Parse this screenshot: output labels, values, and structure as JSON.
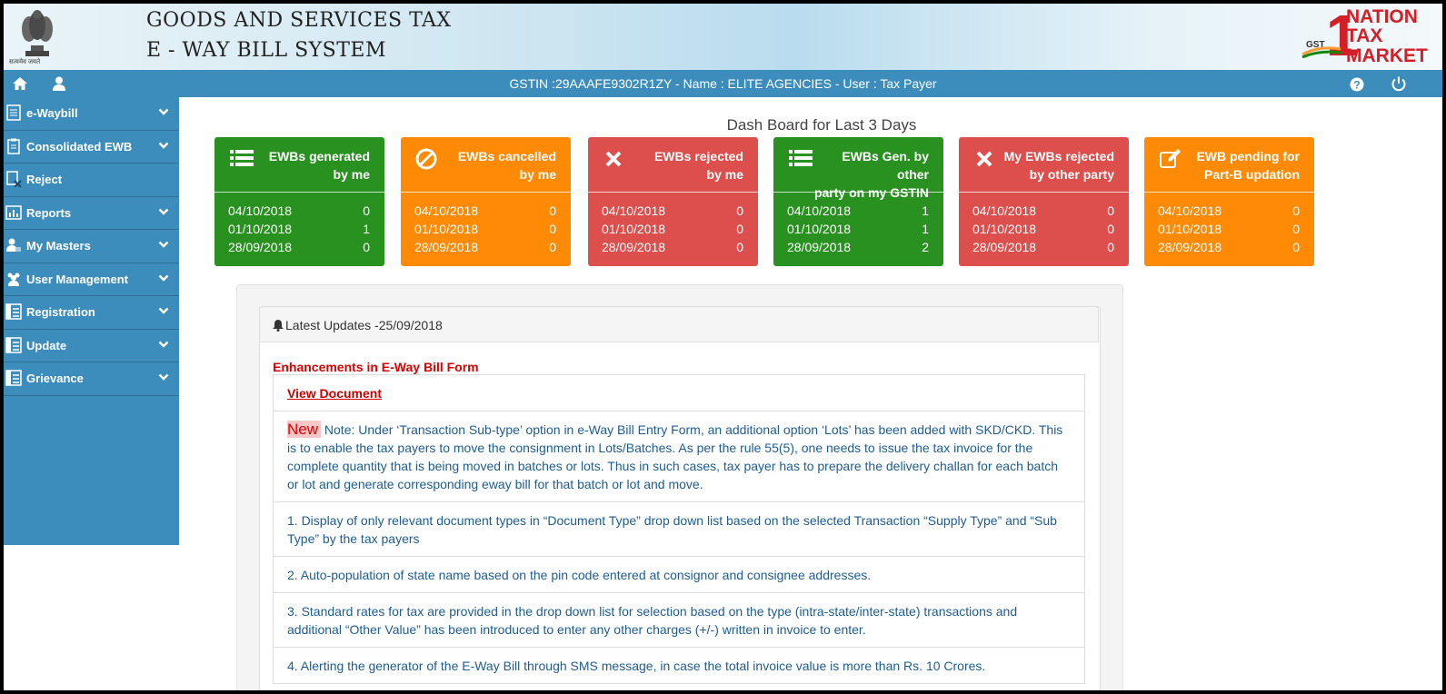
{
  "header": {
    "title_line1": "GOODS AND SERVICES TAX",
    "title_line2": "E - WAY BILL SYSTEM",
    "emblem_caption": "सत्यमेव जयते",
    "logo": {
      "one": "1",
      "line1": "NATION",
      "line2": "TAX",
      "line3": "MARKET",
      "gst": "GST"
    }
  },
  "navbar": {
    "info": "GSTIN :29AAAFE9302R1ZY - Name : ELITE AGENCIES - User : Tax Payer",
    "icons": [
      "home-icon",
      "user-icon",
      "help-icon",
      "power-icon"
    ]
  },
  "sidebar": {
    "items": [
      {
        "label": "e-Waybill",
        "icon": "ewaybill-icon",
        "expandable": true
      },
      {
        "label": "Consolidated EWB",
        "icon": "consolidated-icon",
        "expandable": true
      },
      {
        "label": "Reject",
        "icon": "reject-icon",
        "expandable": false
      },
      {
        "label": "Reports",
        "icon": "reports-icon",
        "expandable": true
      },
      {
        "label": "My Masters",
        "icon": "masters-icon",
        "expandable": true
      },
      {
        "label": "User Management",
        "icon": "users-icon",
        "expandable": true
      },
      {
        "label": "Registration",
        "icon": "registration-icon",
        "expandable": true
      },
      {
        "label": "Update",
        "icon": "update-icon",
        "expandable": true
      },
      {
        "label": "Grievance",
        "icon": "grievance-icon",
        "expandable": true
      }
    ]
  },
  "dashboard": {
    "title": "Dash Board for Last 3 Days",
    "colors": {
      "green": "#28911f",
      "orange": "#ff8a05",
      "red": "#dd4f4c"
    },
    "cards": [
      {
        "title_l1": "EWBs generated",
        "title_l2": "by me",
        "color": "green",
        "icon": "list-icon",
        "rows": [
          {
            "date": "04/10/2018",
            "count": "0"
          },
          {
            "date": "01/10/2018",
            "count": "1"
          },
          {
            "date": "28/09/2018",
            "count": "0"
          }
        ]
      },
      {
        "title_l1": "EWBs cancelled",
        "title_l2": "by me",
        "color": "orange",
        "icon": "ban-icon",
        "rows": [
          {
            "date": "04/10/2018",
            "count": "0"
          },
          {
            "date": "01/10/2018",
            "count": "0"
          },
          {
            "date": "28/09/2018",
            "count": "0"
          }
        ]
      },
      {
        "title_l1": "EWBs rejected",
        "title_l2": "by me",
        "color": "red",
        "icon": "times-icon",
        "rows": [
          {
            "date": "04/10/2018",
            "count": "0"
          },
          {
            "date": "01/10/2018",
            "count": "0"
          },
          {
            "date": "28/09/2018",
            "count": "0"
          }
        ]
      },
      {
        "title_l1": "EWBs Gen. by other",
        "title_l2": "party on my GSTIN",
        "color": "green",
        "icon": "list-icon",
        "rows": [
          {
            "date": "04/10/2018",
            "count": "1"
          },
          {
            "date": "01/10/2018",
            "count": "1"
          },
          {
            "date": "28/09/2018",
            "count": "2"
          }
        ]
      },
      {
        "title_l1": "My EWBs rejected",
        "title_l2": "by other party",
        "color": "red",
        "icon": "times-icon",
        "rows": [
          {
            "date": "04/10/2018",
            "count": "0"
          },
          {
            "date": "01/10/2018",
            "count": "0"
          },
          {
            "date": "28/09/2018",
            "count": "0"
          }
        ]
      },
      {
        "title_l1": "EWB pending for",
        "title_l2": "Part-B updation",
        "color": "orange",
        "icon": "edit-icon",
        "rows": [
          {
            "date": "04/10/2018",
            "count": "0"
          },
          {
            "date": "01/10/2018",
            "count": "0"
          },
          {
            "date": "28/09/2018",
            "count": "0"
          }
        ]
      }
    ]
  },
  "updates": {
    "heading": "Latest Updates -25/09/2018",
    "section_title": "Enhancements in E-Way Bill Form",
    "view_document": "View Document",
    "new_badge": "New",
    "note": " Note:  Under ‘Transaction Sub-type’ option in e-Way Bill Entry Form, an additional option ‘Lots’ has been added with SKD/CKD.  This is to enable the tax payers to move the consignment in Lots/Batches.  As per the rule 55(5), one needs to issue the tax invoice for the complete quantity that is being moved in batches or lots. Thus in such cases, tax payer has to prepare the delivery challan for each batch or lot and generate corresponding eway bill for that batch or lot and move.",
    "items": [
      "1. Display of only relevant document types in “Document Type” drop down list based on the selected Transaction “Supply Type” and “Sub Type” by the tax payers",
      "2. Auto-population of state name based on the pin code entered at consignor and consignee addresses.",
      "3. Standard rates for tax are provided in the drop down list for selection based on the type (intra-state/inter-state) transactions and additional “Other Value” has been introduced to enter any other charges (+/-) written in invoice to enter.",
      "4. Alerting the generator of the E-Way Bill through SMS message, in case the total invoice value is more than Rs. 10 Crores."
    ]
  }
}
